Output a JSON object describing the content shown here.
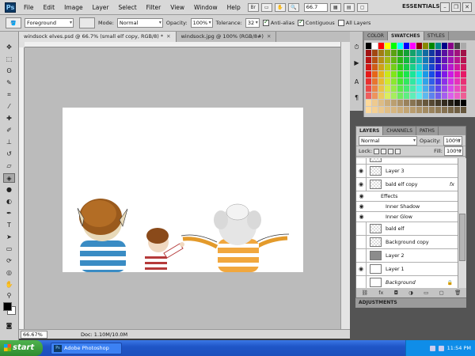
{
  "menubar": {
    "logo": "Ps",
    "items": [
      "File",
      "Edit",
      "Image",
      "Layer",
      "Select",
      "Filter",
      "View",
      "Window",
      "Help"
    ],
    "zoom": "66.7",
    "workspace": "ESSENTIALS"
  },
  "options": {
    "fill_source": "Foreground",
    "mode_label": "Mode:",
    "mode_value": "Normal",
    "opacity_label": "Opacity:",
    "opacity_value": "100%",
    "tolerance_label": "Tolerance:",
    "tolerance_value": "32",
    "antialias_label": "Anti-alias",
    "antialias_checked": true,
    "contiguous_label": "Contiguous",
    "contiguous_checked": true,
    "all_layers_label": "All Layers",
    "all_layers_checked": false
  },
  "doc_tabs": [
    {
      "label": "windsock elves.psd @ 66.7% (small elf copy, RGB/8) *",
      "active": true
    },
    {
      "label": "windsock.jpg @ 100% (RGB/8#)",
      "active": false
    }
  ],
  "status": {
    "zoom": "66.67%",
    "doc_size": "Doc: 1.10M/10.0M"
  },
  "swatches": {
    "tabs": [
      "COLOR",
      "SWATCHES",
      "STYLES"
    ]
  },
  "layers": {
    "tabs": [
      "LAYERS",
      "CHANNELS",
      "PATHS"
    ],
    "blend_mode": "Normal",
    "opacity_label": "Opacity:",
    "opacity_value": "100%",
    "lock_label": "Lock:",
    "fill_label": "Fill:",
    "fill_value": "100%",
    "rows": [
      {
        "name": "Layer 3"
      },
      {
        "name": "bald elf copy",
        "fx": "fx"
      },
      {
        "name": "Effects"
      },
      {
        "name": "Inner Shadow"
      },
      {
        "name": "Inner Glow"
      },
      {
        "name": "bald elf"
      },
      {
        "name": "Background copy"
      },
      {
        "name": "Layer 2"
      },
      {
        "name": "Layer 1"
      },
      {
        "name": "Background"
      }
    ]
  },
  "adjustments": {
    "title": "ADJUSTMENTS"
  },
  "taskbar": {
    "start": "start",
    "task": "Adobe Photoshop CS...",
    "clock": "11:54 PM"
  }
}
